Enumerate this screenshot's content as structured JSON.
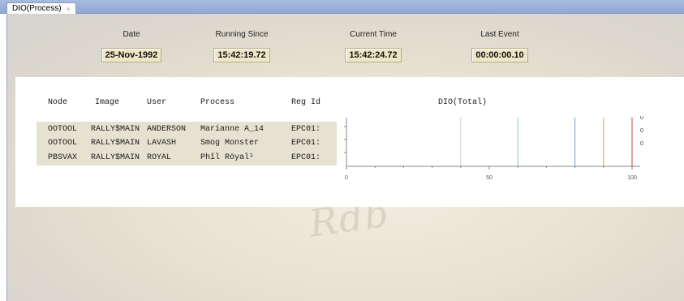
{
  "tab": {
    "label": "DIO(Process)",
    "close_glyph": "×"
  },
  "stats": {
    "date": {
      "label": "Date",
      "value": "25-Nov-1992"
    },
    "running_since": {
      "label": "Running Since",
      "value": "15:42:19.72"
    },
    "current_time": {
      "label": "Current Time",
      "value": "15:42:24.72"
    },
    "last_event": {
      "label": "Last Event",
      "value": "00:00:00.10"
    }
  },
  "watermark": "Rdb",
  "table": {
    "headers": [
      "Node",
      "Image",
      "User",
      "Process",
      "Reg Id"
    ],
    "rows": [
      {
        "node": "OOTOOL",
        "image": "RALLY$MAIN",
        "user": "ANDERSON",
        "process": "Marianne A_14",
        "reg_id": "EPC01:"
      },
      {
        "node": "OOTOOL",
        "image": "RALLY$MAIN",
        "user": "LAVASH",
        "process": "Smog Monster",
        "reg_id": "EPC01:"
      },
      {
        "node": "PBSVAX",
        "image": "RALLY$MAIN",
        "user": "ROYAL",
        "process": "Phîl Röyal¹",
        "reg_id": "EPC01:"
      }
    ]
  },
  "chart_data": {
    "type": "bar",
    "title": "DIO(Total)",
    "categories": [
      "Marianne A_14",
      "Smog Monster",
      "Phîl Röyal¹"
    ],
    "values": [
      0,
      0,
      0
    ],
    "value_labels": [
      "0",
      "0",
      "0"
    ],
    "xlim": [
      0,
      100
    ],
    "x_ticks": [
      "0",
      "50",
      "100"
    ],
    "marker_lines": [
      {
        "x": 40,
        "color": "#c8cccf"
      },
      {
        "x": 60,
        "color": "#8fc2c9"
      },
      {
        "x": 80,
        "color": "#6f9fd0"
      },
      {
        "x": 90,
        "color": "#e8a030"
      },
      {
        "x": 100,
        "color": "#c84040"
      }
    ],
    "grid": false,
    "legend": "none"
  }
}
